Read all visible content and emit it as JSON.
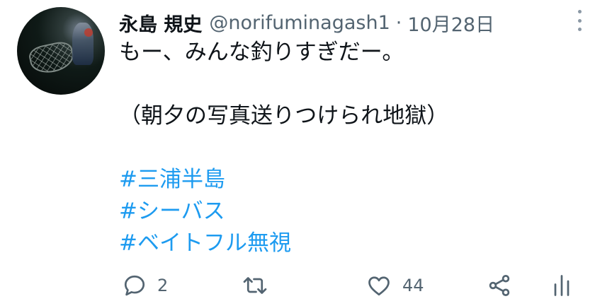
{
  "tweet": {
    "author_name": "永島 規史",
    "handle": "@norifuminagash1",
    "separator": "·",
    "date": "10月28日",
    "lines": [
      "もー、みんな釣りすぎだー。",
      "",
      "（朝夕の写真送りつけられ地獄）",
      "",
      "#三浦半島",
      "#シーバス",
      "#ベイトフル無視"
    ]
  },
  "actions": {
    "reply_count": "2",
    "retweet_count": "",
    "like_count": "44"
  },
  "icons": {
    "reply": "reply-icon",
    "retweet": "retweet-icon",
    "like": "heart-icon",
    "share": "share-icon",
    "analytics": "analytics-icon",
    "more": "more-vertical-icon"
  },
  "colors": {
    "link": "#1d9bf0",
    "muted": "#536471",
    "text": "#0f1419"
  }
}
